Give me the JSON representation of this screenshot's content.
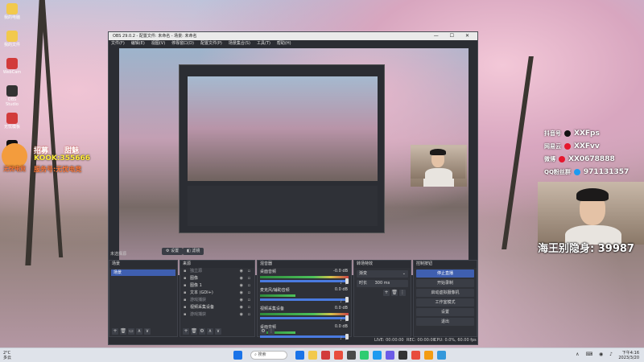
{
  "desktop": {
    "icons": [
      {
        "label": "我的电脑",
        "color": "#f2c94c"
      },
      {
        "label": "我的文件",
        "color": "#f2c94c"
      },
      {
        "label": "WebCam",
        "color": "#d23b3b"
      },
      {
        "label": "OBS Studio",
        "color": "#333333"
      },
      {
        "label": "无忧模板",
        "color": "#d23b3b"
      },
      {
        "label": "剪映专业版",
        "color": "#111111"
      }
    ],
    "promo_lines": [
      "招募",
      "甜魅",
      "KOOK:355666",
      "服务号:无忧电竞"
    ],
    "promo_brand": "无忧电竞"
  },
  "obs": {
    "title": "OBS 29.0.2 - 配置文件: 未命名 - 场景: 未命名",
    "window_controls": "—  ☐  ✕",
    "menu": [
      "文件(F)",
      "编辑(E)",
      "视图(V)",
      "停靠窗口(D)",
      "配置文件(P)",
      "场景集合(S)",
      "工具(T)",
      "帮助(H)"
    ],
    "tabs": {
      "settings_label": "设置",
      "filters_label": "滤镜"
    },
    "no_source_selected": "未选择源",
    "scenes": {
      "title": "场景",
      "items": [
        "场景"
      ],
      "footer": [
        "+",
        "🗑",
        "▭",
        "∧",
        "∨"
      ]
    },
    "sources": {
      "title": "来源",
      "items": [
        {
          "name": "独立源",
          "dim": true
        },
        {
          "name": "图像",
          "dim": false
        },
        {
          "name": "图像 1",
          "dim": false
        },
        {
          "name": "文本 (GDI+)",
          "dim": false
        },
        {
          "name": "游戏捕获",
          "dim": true
        },
        {
          "name": "视频采集设备",
          "dim": false
        },
        {
          "name": "游戏捕获",
          "dim": true
        }
      ],
      "footer": [
        "+",
        "🗑",
        "⚙",
        "∧",
        "∨"
      ]
    },
    "mixer": {
      "title": "混音器",
      "channels": [
        {
          "name": "桌面音频",
          "db": "-0.0 dB"
        },
        {
          "name": "麦克风/辅助音频",
          "db": "0.0 dB"
        },
        {
          "name": "视频采集设备",
          "db": "0.0 dB"
        },
        {
          "name": "桌面音频",
          "db": "0.0 dB"
        }
      ],
      "footer": [
        "⚙",
        "⋮"
      ]
    },
    "transitions": {
      "title": "转场特效",
      "type": "渐变",
      "duration_label": "时长",
      "duration_value": "300 ms",
      "footer": [
        "+",
        "🗑",
        "⋮"
      ]
    },
    "controls": {
      "title": "控制按钮",
      "buttons": [
        {
          "label": "停止直播",
          "active": true
        },
        {
          "label": "开始录制",
          "active": false
        },
        {
          "label": "启动虚拟摄像机",
          "active": false
        },
        {
          "label": "工作室模式",
          "active": false
        },
        {
          "label": "设置",
          "active": false
        },
        {
          "label": "退出",
          "active": false
        }
      ]
    },
    "status": {
      "live": "LIVE: 00:00:00",
      "rec": "REC: 00:00:00",
      "cpu": "CPU: 0.0%, 60.00 fps"
    }
  },
  "overlay": {
    "lines": [
      {
        "icon": "douyin-icon",
        "platform": "抖音号",
        "text": "XXFps"
      },
      {
        "icon": "weibo-icon",
        "platform": "网易云",
        "text": "XXFvv"
      },
      {
        "icon": "weibo-icon",
        "platform": "微博",
        "text": "XX0678888"
      },
      {
        "icon": "qq-icon",
        "platform": "QQ粉丝群",
        "text": "971131357"
      }
    ],
    "counter_text": "海王别隐身: 39987"
  },
  "taskbar": {
    "weather_temp": "2°C",
    "weather_desc": "多云",
    "search_placeholder": "搜索",
    "time": "下午4:16",
    "date": "2023/3/20",
    "app_colors": [
      "#1a73e8",
      "#f2c94c",
      "#d23b3b",
      "#e84c3d",
      "#4a4a4a",
      "#2ecc71",
      "#1d9bf0",
      "#6c5ce7",
      "#333333",
      "#e84c3d",
      "#f39c12",
      "#3498db"
    ]
  },
  "colors": {
    "accent": "#3f5fb0",
    "obs_bg": "#2b2d33"
  }
}
